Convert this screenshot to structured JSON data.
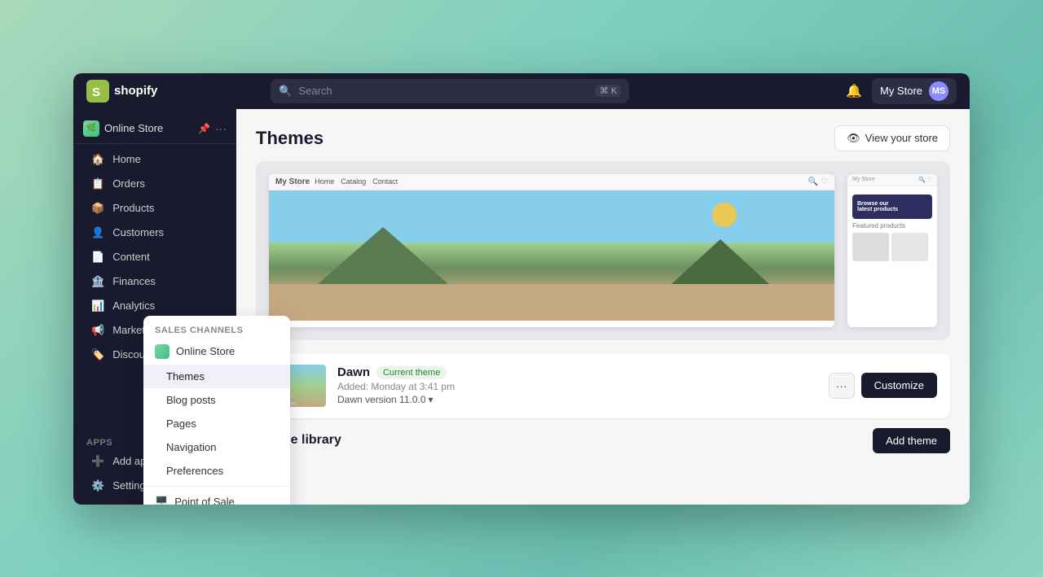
{
  "titlebar": {
    "logo_text": "shopify",
    "search_placeholder": "Search",
    "search_shortcut": "⌘ K",
    "store_name": "My Store"
  },
  "breadcrumb": {
    "store_name": "Online Store"
  },
  "sidebar": {
    "items": [
      {
        "id": "home",
        "label": "Home",
        "icon": "🏠"
      },
      {
        "id": "orders",
        "label": "Orders",
        "icon": "📋"
      },
      {
        "id": "products",
        "label": "Products",
        "icon": "📦"
      },
      {
        "id": "customers",
        "label": "Customers",
        "icon": "👤"
      },
      {
        "id": "content",
        "label": "Content",
        "icon": "📄"
      },
      {
        "id": "finances",
        "label": "Finances",
        "icon": "🏦"
      },
      {
        "id": "analytics",
        "label": "Analytics",
        "icon": "📊"
      },
      {
        "id": "marketing",
        "label": "Marketing",
        "icon": "📢"
      },
      {
        "id": "discounts",
        "label": "Discounts",
        "icon": "🏷️"
      }
    ],
    "bottom": [
      {
        "id": "apps",
        "label": "Apps"
      },
      {
        "id": "add-apps",
        "label": "Add apps"
      },
      {
        "id": "settings",
        "label": "Settings",
        "icon": "⚙️"
      }
    ]
  },
  "dropdown": {
    "section_label": "Sales channels",
    "items": [
      {
        "id": "online-store",
        "label": "Online Store",
        "icon": "store"
      },
      {
        "id": "themes",
        "label": "Themes",
        "indent": true
      },
      {
        "id": "blog-posts",
        "label": "Blog posts",
        "indent": true
      },
      {
        "id": "pages",
        "label": "Pages",
        "indent": true
      },
      {
        "id": "navigation",
        "label": "Navigation",
        "indent": true
      },
      {
        "id": "preferences",
        "label": "Preferences",
        "indent": true
      }
    ],
    "pos": {
      "id": "point-of-sale",
      "label": "Point of Sale"
    }
  },
  "main": {
    "title": "Themes",
    "view_store_btn": "View your store",
    "dawn": {
      "name": "Dawn",
      "badge": "Current theme",
      "added": "Added: Monday at 3:41 pm",
      "version": "Dawn version 11.0.0",
      "more_label": "···",
      "customize_label": "Customize"
    },
    "theme_library": {
      "title": "Theme library",
      "add_theme_btn": "Add theme"
    }
  },
  "colors": {
    "sidebar_bg": "#1c1c2d",
    "accent": "#1a1a2e",
    "badge_green_bg": "#e8f5e9",
    "badge_green_text": "#2e7d32"
  }
}
